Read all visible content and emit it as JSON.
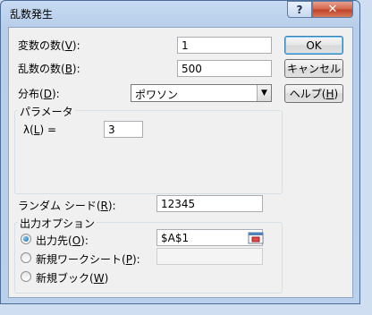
{
  "window": {
    "title": "乱数発生",
    "help_glyph": "?",
    "close_glyph": "✕"
  },
  "fields": {
    "num_variables": {
      "label_pre": "変数の数(",
      "key": "V",
      "label_post": "):",
      "value": "1"
    },
    "num_random": {
      "label_pre": "乱数の数(",
      "key": "B",
      "label_post": "):",
      "value": "500"
    },
    "distribution": {
      "label_pre": "分布(",
      "key": "D",
      "label_post": "):",
      "value": "ポワソン",
      "arrow": "▼"
    },
    "parameters_group": "パラメータ",
    "lambda": {
      "label_pre": "λ(",
      "key": "L",
      "label_post": ") =",
      "value": "3"
    },
    "seed": {
      "label_pre": "ランダム シード(",
      "key": "R",
      "label_post": "):",
      "value": "12345"
    }
  },
  "buttons": {
    "ok": "OK",
    "cancel": "キャンセル",
    "help_pre": "ヘルプ(",
    "help_key": "H",
    "help_post": ")"
  },
  "output": {
    "group_label": "出力オプション",
    "options": [
      {
        "label_pre": "出力先(",
        "key": "O",
        "label_post": "):",
        "checked": true
      },
      {
        "label_pre": "新規ワークシート(",
        "key": "P",
        "label_post": "):",
        "checked": false
      },
      {
        "label_pre": "新規ブック(",
        "key": "W",
        "label_post": ")",
        "checked": false
      }
    ],
    "output_range_value": "$A$1",
    "new_sheet_value": ""
  },
  "colors": {
    "title_bar": "#b9cfea",
    "close_button": "#c1432a",
    "client_bg": "#f0f0f0",
    "radio_dot": "#1a5fa5"
  },
  "icons": {
    "range_selector": "range-select-icon",
    "dropdown": "chevron-down-icon"
  }
}
